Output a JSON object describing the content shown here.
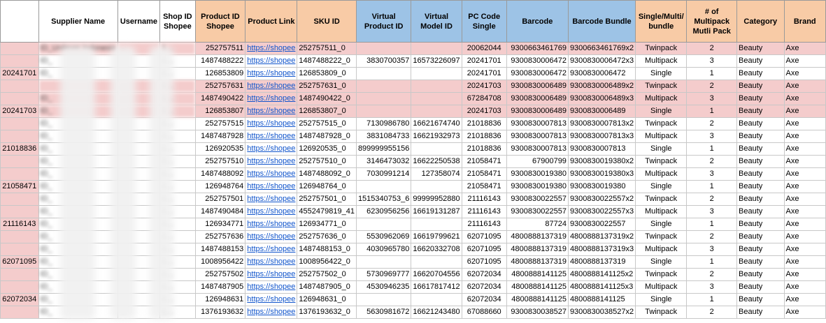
{
  "headers": [
    {
      "label": "",
      "style": "corner"
    },
    {
      "label": "Supplier Name",
      "style": "white"
    },
    {
      "label": "Username",
      "style": "white"
    },
    {
      "label": "Shop ID Shopee",
      "style": "white"
    },
    {
      "label": "Product ID Shopee",
      "style": "orange"
    },
    {
      "label": "Product Link",
      "style": "orange"
    },
    {
      "label": "SKU ID",
      "style": "orange"
    },
    {
      "label": "Virtual Product ID",
      "style": "blue"
    },
    {
      "label": "Virtual Model ID",
      "style": "blue"
    },
    {
      "label": "PC Code Single",
      "style": "blue"
    },
    {
      "label": "Barcode",
      "style": "blue"
    },
    {
      "label": "Barcode Bundle",
      "style": "blue"
    },
    {
      "label": "Single/Multi/ bundle",
      "style": "orange"
    },
    {
      "label": "# of Multipack Mutli Pack",
      "style": "orange"
    },
    {
      "label": "Category",
      "style": "orange"
    },
    {
      "label": "Brand",
      "style": "orange"
    }
  ],
  "rows": [
    {
      "group": "",
      "pink": true,
      "supplier": "ID_Unilever Indonesia",
      "username": "…",
      "shop": "1…",
      "product_id": "252757511",
      "link": "https://shopee",
      "sku": "252757511_0",
      "vp": "",
      "vm": "",
      "pc": "20062044",
      "barcode": "9300663461769",
      "bundle": "9300663461769x2",
      "type": "Twinpack",
      "n": "2",
      "category": "Beauty",
      "brand": "Axe"
    },
    {
      "group": "",
      "pink": false,
      "supplier": "ID_",
      "username": "…",
      "shop": "1…",
      "product_id": "1487488222",
      "link": "https://shopee",
      "sku": "1487488222_0",
      "vp": "3830700357",
      "vm": "16573226097",
      "pc": "20241701",
      "barcode": "9300830006472",
      "bundle": "9300830006472x3",
      "type": "Multipack",
      "n": "3",
      "category": "Beauty",
      "brand": "Axe"
    },
    {
      "group": "20241701",
      "pink": false,
      "supplier": "ID_",
      "username": "…",
      "shop": "1…",
      "product_id": "126853809",
      "link": "https://shopee",
      "sku": "126853809_0",
      "vp": "",
      "vm": "",
      "pc": "20241701",
      "barcode": "9300830006472",
      "bundle": "9300830006472",
      "type": "Single",
      "n": "1",
      "category": "Beauty",
      "brand": "Axe"
    },
    {
      "group": "",
      "pink": true,
      "supplier": "",
      "username": "…",
      "shop": "1…",
      "product_id": "252757631",
      "link": "https://shopee",
      "sku": "252757631_0",
      "vp": "",
      "vm": "",
      "pc": "20241703",
      "barcode": "9300830006489",
      "bundle": "9300830006489x2",
      "type": "Twinpack",
      "n": "2",
      "category": "Beauty",
      "brand": "Axe"
    },
    {
      "group": "",
      "pink": true,
      "supplier": "ID_",
      "username": "…",
      "shop": "1…",
      "product_id": "1487490422",
      "link": "https://shopee",
      "sku": "1487490422_0",
      "vp": "",
      "vm": "",
      "pc": "67284708",
      "barcode": "9300830006489",
      "bundle": "9300830006489x3",
      "type": "Multipack",
      "n": "3",
      "category": "Beauty",
      "brand": "Axe"
    },
    {
      "group": "20241703",
      "pink": true,
      "supplier": "ID_",
      "username": "…",
      "shop": "1…",
      "product_id": "126853807",
      "link": "https://shopee",
      "sku": "126853807_0",
      "vp": "",
      "vm": "",
      "pc": "20241703",
      "barcode": "9300830006489",
      "bundle": "9300830006489",
      "type": "Single",
      "n": "1",
      "category": "Beauty",
      "brand": "Axe"
    },
    {
      "group": "",
      "pink": false,
      "supplier": "ID_",
      "username": "…",
      "shop": "1…",
      "product_id": "252757515",
      "link": "https://shopee",
      "sku": "252757515_0",
      "vp": "7130986780",
      "vm": "16621674740",
      "pc": "21018836",
      "barcode": "9300830007813",
      "bundle": "9300830007813x2",
      "type": "Twinpack",
      "n": "2",
      "category": "Beauty",
      "brand": "Axe"
    },
    {
      "group": "",
      "pink": false,
      "supplier": "ID_",
      "username": "…",
      "shop": "1…",
      "product_id": "1487487928",
      "link": "https://shopee",
      "sku": "1487487928_0",
      "vp": "3831084733",
      "vm": "16621932973",
      "pc": "21018836",
      "barcode": "9300830007813",
      "bundle": "9300830007813x3",
      "type": "Multipack",
      "n": "3",
      "category": "Beauty",
      "brand": "Axe"
    },
    {
      "group": "21018836",
      "pink": false,
      "supplier": "ID_",
      "username": "…",
      "shop": "1…",
      "product_id": "126920535",
      "link": "https://shopee",
      "sku": "126920535_0",
      "vp": "899999955156",
      "vm": "",
      "pc": "21018836",
      "barcode": "9300830007813",
      "bundle": "9300830007813",
      "type": "Single",
      "n": "1",
      "category": "Beauty",
      "brand": "Axe"
    },
    {
      "group": "",
      "pink": false,
      "supplier": "ID_",
      "username": "…",
      "shop": "1…",
      "product_id": "252757510",
      "link": "https://shopee",
      "sku": "252757510_0",
      "vp": "3146473032",
      "vm": "16622250538",
      "pc": "21058471",
      "barcode": "67900799",
      "bundle": "9300830019380x2",
      "type": "Twinpack",
      "n": "2",
      "category": "Beauty",
      "brand": "Axe"
    },
    {
      "group": "",
      "pink": false,
      "supplier": "ID_",
      "username": "…",
      "shop": "1…",
      "product_id": "1487488092",
      "link": "https://shopee",
      "sku": "1487488092_0",
      "vp": "7030991214",
      "vm": "127358074",
      "pc": "21058471",
      "barcode": "9300830019380",
      "bundle": "9300830019380x3",
      "type": "Multipack",
      "n": "3",
      "category": "Beauty",
      "brand": "Axe"
    },
    {
      "group": "21058471",
      "pink": false,
      "supplier": "ID_",
      "username": "…",
      "shop": "1…",
      "product_id": "126948764",
      "link": "https://shopee",
      "sku": "126948764_0",
      "vp": "",
      "vm": "",
      "pc": "21058471",
      "barcode": "9300830019380",
      "bundle": "9300830019380",
      "type": "Single",
      "n": "1",
      "category": "Beauty",
      "brand": "Axe"
    },
    {
      "group": "",
      "pink": false,
      "supplier": "ID_",
      "username": "…",
      "shop": "1…",
      "product_id": "252757501",
      "link": "https://shopee",
      "sku": "252757501_0",
      "vp": "1515340753_6",
      "vm": "99999952880",
      "pc": "21116143",
      "barcode": "9300830022557",
      "bundle": "9300830022557x2",
      "type": "Twinpack",
      "n": "2",
      "category": "Beauty",
      "brand": "Axe"
    },
    {
      "group": "",
      "pink": false,
      "supplier": "ID_",
      "username": "…",
      "shop": "1…",
      "product_id": "1487490484",
      "link": "https://shopee",
      "sku": "4552479819_41",
      "vp": "6230956256",
      "vm": "16619131287",
      "pc": "21116143",
      "barcode": "9300830022557",
      "bundle": "9300830022557x3",
      "type": "Multipack",
      "n": "3",
      "category": "Beauty",
      "brand": "Axe"
    },
    {
      "group": "21116143",
      "pink": false,
      "supplier": "ID_",
      "username": "…",
      "shop": "1…",
      "product_id": "126934771",
      "link": "https://shopee",
      "sku": "126934771_0",
      "vp": "",
      "vm": "",
      "pc": "21116143",
      "barcode": "87724",
      "bundle": "9300830022557",
      "type": "Single",
      "n": "1",
      "category": "Beauty",
      "brand": "Axe"
    },
    {
      "group": "",
      "pink": false,
      "supplier": "ID_",
      "username": "…",
      "shop": "1…",
      "product_id": "252757636",
      "link": "https://shopee",
      "sku": "252757636_0",
      "vp": "5530962069",
      "vm": "16619799621",
      "pc": "62071095",
      "barcode": "4800888137319",
      "bundle": "4800888137319x2",
      "type": "Twinpack",
      "n": "2",
      "category": "Beauty",
      "brand": "Axe"
    },
    {
      "group": "",
      "pink": false,
      "supplier": "ID_",
      "username": "…",
      "shop": "1…",
      "product_id": "1487488153",
      "link": "https://shopee",
      "sku": "1487488153_0",
      "vp": "4030965780",
      "vm": "16620332708",
      "pc": "62071095",
      "barcode": "4800888137319",
      "bundle": "4800888137319x3",
      "type": "Multipack",
      "n": "3",
      "category": "Beauty",
      "brand": "Axe"
    },
    {
      "group": "62071095",
      "pink": false,
      "supplier": "ID_",
      "username": "…",
      "shop": "1…",
      "product_id": "1008956422",
      "link": "https://shopee",
      "sku": "1008956422_0",
      "vp": "",
      "vm": "",
      "pc": "62071095",
      "barcode": "4800888137319",
      "bundle": "4800888137319",
      "type": "Single",
      "n": "1",
      "category": "Beauty",
      "brand": "Axe"
    },
    {
      "group": "",
      "pink": false,
      "supplier": "ID_",
      "username": "…",
      "shop": "1…",
      "product_id": "252757502",
      "link": "https://shopee",
      "sku": "252757502_0",
      "vp": "5730969777",
      "vm": "16620704556",
      "pc": "62072034",
      "barcode": "4800888141125",
      "bundle": "4800888141125x2",
      "type": "Twinpack",
      "n": "2",
      "category": "Beauty",
      "brand": "Axe"
    },
    {
      "group": "",
      "pink": false,
      "supplier": "ID_",
      "username": "…",
      "shop": "1…",
      "product_id": "1487487905",
      "link": "https://shopee",
      "sku": "1487487905_0",
      "vp": "4530946235",
      "vm": "16617817412",
      "pc": "62072034",
      "barcode": "4800888141125",
      "bundle": "4800888141125x3",
      "type": "Multipack",
      "n": "3",
      "category": "Beauty",
      "brand": "Axe"
    },
    {
      "group": "62072034",
      "pink": false,
      "supplier": "ID_",
      "username": "…",
      "shop": "1…",
      "product_id": "126948631",
      "link": "https://shopee",
      "sku": "126948631_0",
      "vp": "",
      "vm": "",
      "pc": "62072034",
      "barcode": "4800888141125",
      "bundle": "4800888141125",
      "type": "Single",
      "n": "1",
      "category": "Beauty",
      "brand": "Axe"
    },
    {
      "group": "",
      "pink": false,
      "supplier": "ID_",
      "username": "…",
      "shop": "1…",
      "product_id": "1376193632",
      "link": "https://shopee",
      "sku": "1376193632_0",
      "vp": "5630981672",
      "vm": "16621243480",
      "pc": "67088660",
      "barcode": "9300830038527",
      "bundle": "9300830038527x2",
      "type": "Twinpack",
      "n": "2",
      "category": "Beauty",
      "brand": "Axe"
    }
  ]
}
